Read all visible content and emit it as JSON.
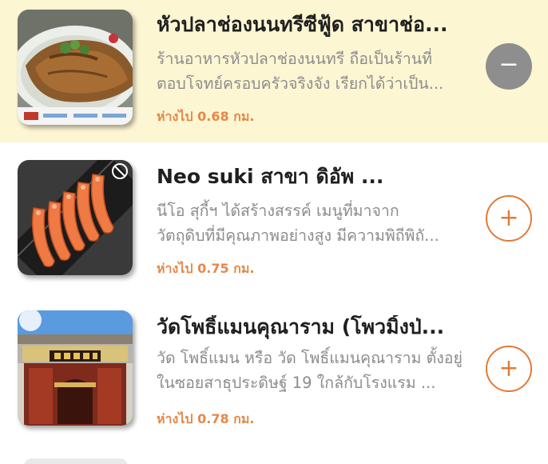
{
  "places": [
    {
      "title": "หัวปลาช่องนนทรีซีฟู้ด สาขาช่อ...",
      "description_lines": [
        "ร้านอาหารหัวปลาช่องนนทรี ถือเป็นร้านที่",
        "ตอบโจทย์ครอบครัวจริงจัง เรียกได้ว่าเป็น..."
      ],
      "distance": "ห่างไป 0.68 กม.",
      "action": "remove",
      "action_symbol": "−",
      "selected": true,
      "image": "fried-fish-dish"
    },
    {
      "title": "Neo suki สาขา ดิอัพ ...",
      "description_lines": [
        "นีโอ สุกี้ฯ ได้สร้างสรรค์ เมนูที่มาจาก",
        "วัตถุดิบที่มีคุณภาพอย่างสูง มีความพิถีพิถั..."
      ],
      "distance": "ห่างไป 0.75 กม.",
      "action": "add",
      "action_symbol": "+",
      "selected": false,
      "image": "grilled-shrimp-dish"
    },
    {
      "title": "วัดโพธิ์แมนคุณาราม (โพวมิ้งป่...",
      "description_lines": [
        "วัด โพธิ์แมน หรือ วัด โพธิ์แมนคุณาราม ตั้งอยู่",
        "ในซอยสาธุประดิษฐ์ 19 ใกล้กับโรงแรม ..."
      ],
      "distance": "ห่างไป 0.78 กม.",
      "action": "add",
      "action_symbol": "+",
      "selected": false,
      "image": "chinese-temple-gate"
    }
  ],
  "colors": {
    "selected_background": "#fdf6d3",
    "accent": "#e07b39",
    "distance_text": "#e4884a",
    "remove_button": "#8e8e8e"
  }
}
